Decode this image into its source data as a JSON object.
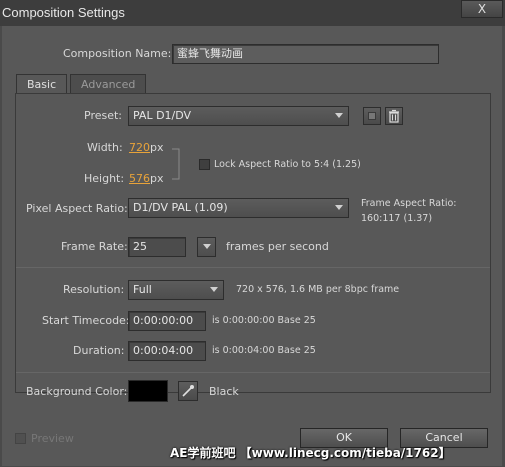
{
  "window": {
    "title": "Composition Settings",
    "close_label": "X"
  },
  "comp_name": {
    "label": "Composition Name:",
    "value": "蜜蜂飞舞动画"
  },
  "tabs": [
    {
      "label": "Basic"
    },
    {
      "label": "Advanced"
    }
  ],
  "preset": {
    "label": "Preset:",
    "value": "PAL D1/DV"
  },
  "width": {
    "label": "Width:",
    "value": "720",
    "unit": "px"
  },
  "height": {
    "label": "Height:",
    "value": "576",
    "unit": "px"
  },
  "lock_aspect": {
    "label": "Lock Aspect Ratio to 5:4 (1.25)",
    "checked": false
  },
  "pixel_aspect": {
    "label": "Pixel Aspect Ratio:",
    "value": "D1/DV PAL (1.09)"
  },
  "frame_aspect": {
    "label": "Frame Aspect Ratio:",
    "value": "160:117 (1.37)"
  },
  "frame_rate": {
    "label": "Frame Rate:",
    "value": "25",
    "unit": "frames per second"
  },
  "resolution": {
    "label": "Resolution:",
    "value": "Full",
    "info": "720 x 576, 1.6 MB per 8bpc frame"
  },
  "start_timecode": {
    "label": "Start Timecode:",
    "value": "0:00:00:00",
    "info": "is 0:00:00:00  Base 25"
  },
  "duration": {
    "label": "Duration:",
    "value": "0:00:04:00",
    "info": "is 0:00:04:00  Base 25"
  },
  "background": {
    "label": "Background Color:",
    "color": "#000000",
    "name": "Black"
  },
  "footer": {
    "preview_label": "Preview",
    "ok_label": "OK",
    "cancel_label": "Cancel"
  },
  "watermark": "AE学前班吧 【www.linecg.com/tieba/1762】"
}
